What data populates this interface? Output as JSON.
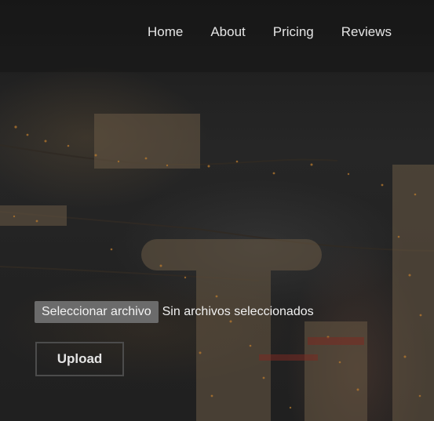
{
  "nav": {
    "items": [
      {
        "label": "Home"
      },
      {
        "label": "About"
      },
      {
        "label": "Pricing"
      },
      {
        "label": "Reviews"
      }
    ]
  },
  "upload_form": {
    "file_button_label": "Seleccionar archivo",
    "file_status": "Sin archivos seleccionados",
    "upload_button_label": "Upload"
  },
  "colors": {
    "navbar_overlay": "#141414",
    "text": "#e5e5e5",
    "file_button": "#6b6b6b",
    "upload_border": "#4c4c4c"
  }
}
